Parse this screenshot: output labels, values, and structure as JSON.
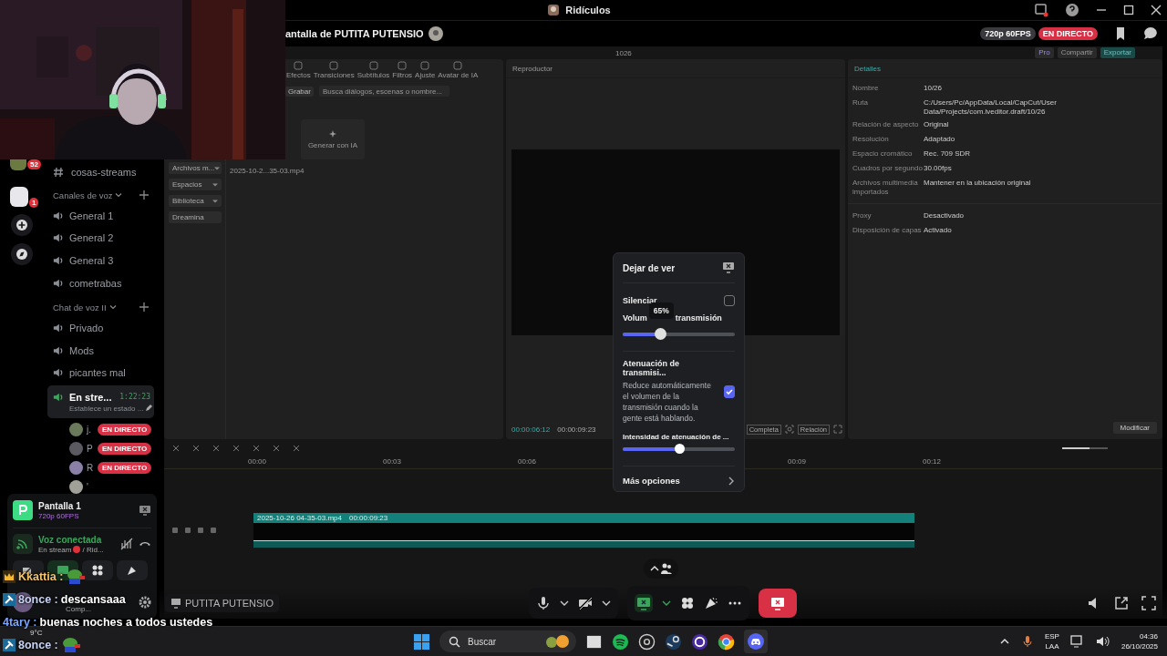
{
  "window": {
    "title": "Ridículos"
  },
  "server_rail": {
    "badges": [
      "52",
      "1"
    ]
  },
  "channels": {
    "text_channel": "cosas-streams",
    "groups": [
      {
        "name": "Canales de voz",
        "items": [
          {
            "name": "General 1",
            "selected": false
          },
          {
            "name": "General 2",
            "selected": false
          },
          {
            "name": "General 3",
            "selected": false
          },
          {
            "name": "cometrabas",
            "selected": false
          }
        ]
      },
      {
        "name": "Chat de voz II",
        "items": [
          {
            "name": "Privado",
            "selected": false
          },
          {
            "name": "Mods",
            "selected": false
          },
          {
            "name": "picantes mal",
            "selected": false
          },
          {
            "name": "En stre...",
            "selected": true,
            "timer": "1:22:23",
            "status": "Establece un estado ..."
          }
        ]
      }
    ],
    "members": [
      {
        "name": "j.",
        "badge": "EN DIRECTO",
        "color": "#6a7a5a"
      },
      {
        "name": "P",
        "badge": "EN DIRECTO",
        "color": "#5a5a60"
      },
      {
        "name": "R",
        "badge": "EN DIRECTO",
        "color": "#8a80a8"
      },
      {
        "name": "'",
        "color": "#a0a098"
      }
    ]
  },
  "stream_panel": {
    "title": "Pantalla 1",
    "quality": "720p 60FPS"
  },
  "voice_panel": {
    "status": "Voz conectada",
    "detail": "En stream",
    "channel": "/ Rid..."
  },
  "user_panel": {
    "activity": "Comp..."
  },
  "stream_header": {
    "title": "antalla de PUTITA PUTENSIO",
    "quality": "720p 60FPS",
    "live": "EN DIRECTO"
  },
  "capcut": {
    "project": "1026",
    "header_buttons": [
      {
        "label": "Pro",
        "kind": "pro"
      },
      {
        "label": "Compartir",
        "kind": "plain"
      },
      {
        "label": "Exportar",
        "kind": "primary"
      }
    ],
    "tabs": [
      "Efectos",
      "Transiciones",
      "Subtítulos",
      "Filtros",
      "Ajuste",
      "Avatar de IA"
    ],
    "record_button": "Grabar",
    "search_placeholder": "Busca diálogos, escenas o nombre...",
    "sidebar": [
      {
        "label": "Archivos m...",
        "expandable": true
      },
      {
        "label": "Espacios",
        "expandable": true
      },
      {
        "label": "Biblioteca",
        "expandable": true
      },
      {
        "label": "Dreamina",
        "expandable": false
      }
    ],
    "media_file": "2025-10-2...35-03.mp4",
    "generate": "Generar con IA",
    "player": {
      "title": "Reproductor",
      "current": "00:00:06:12",
      "total": "00:00:09:23",
      "buttons": [
        "Completa",
        "Relación"
      ]
    },
    "details": {
      "title": "Detalles",
      "rows": [
        {
          "label": "Nombre",
          "value": "10/26"
        },
        {
          "label": "Ruta",
          "value": "C:/Users/Pc/AppData/Local/CapCut/User Data/Projects/com.lveditor.draft/10/26"
        },
        {
          "label": "Relación de aspecto",
          "value": "Original"
        },
        {
          "label": "Resolución",
          "value": "Adaptado"
        },
        {
          "label": "Espacio cromático",
          "value": "Rec. 709 SDR"
        },
        {
          "label": "Cuadros por segundo",
          "value": "30.00fps"
        },
        {
          "label": "Archivos multimedia importados",
          "value": "Mantener en la ubicación original"
        },
        {
          "label": "Proxy",
          "value": "Desactivado"
        },
        {
          "label": "Disposición de capas",
          "value": "Activado"
        }
      ],
      "button": "Modificar"
    },
    "timeline": {
      "ticks": [
        "00:00",
        "00:03",
        "00:06",
        "00:09",
        "00:12"
      ],
      "clip_name": "2025-10-26 04-35-03.mp4",
      "clip_duration": "00:00:09:23"
    }
  },
  "stream_footer": {
    "streamer": "PUTITA PUTENSIO"
  },
  "popup": {
    "title": "Dejar de ver",
    "mute": {
      "label": "Silenciar",
      "checked": false
    },
    "volume": {
      "label_start": "Volum",
      "label_end": "transmisión",
      "tooltip": "65%",
      "level": 0.33
    },
    "attenuation": {
      "title": "Atenuación de transmisi...",
      "description": "Reduce automáticamente el volumen de la transmisión cuando la gente está hablando.",
      "checked": true
    },
    "intensity": {
      "label": "Intensidad de atenuación de ...",
      "level": 0.5
    },
    "more": "Más opciones"
  },
  "chat": [
    {
      "user": "Kkattia :",
      "kind": "crown",
      "color": "#f2c46a",
      "emote": true
    },
    {
      "user": "8once :",
      "text": "descansaaa",
      "kind": "mod",
      "color": "#c9d4f5",
      "emote": false
    },
    {
      "user": "4tary :",
      "text": "buenas noches a todos ustedes",
      "kind": "none",
      "color": "#7aa6ff",
      "emote": false
    },
    {
      "user": "8once :",
      "kind": "mod",
      "color": "#c9d4f5",
      "emote": true
    }
  ],
  "taskbar": {
    "weather": "9°C",
    "search": "Buscar",
    "language": [
      "ESP",
      "LAA"
    ],
    "time": "04:36",
    "date": "26/10/2025"
  }
}
